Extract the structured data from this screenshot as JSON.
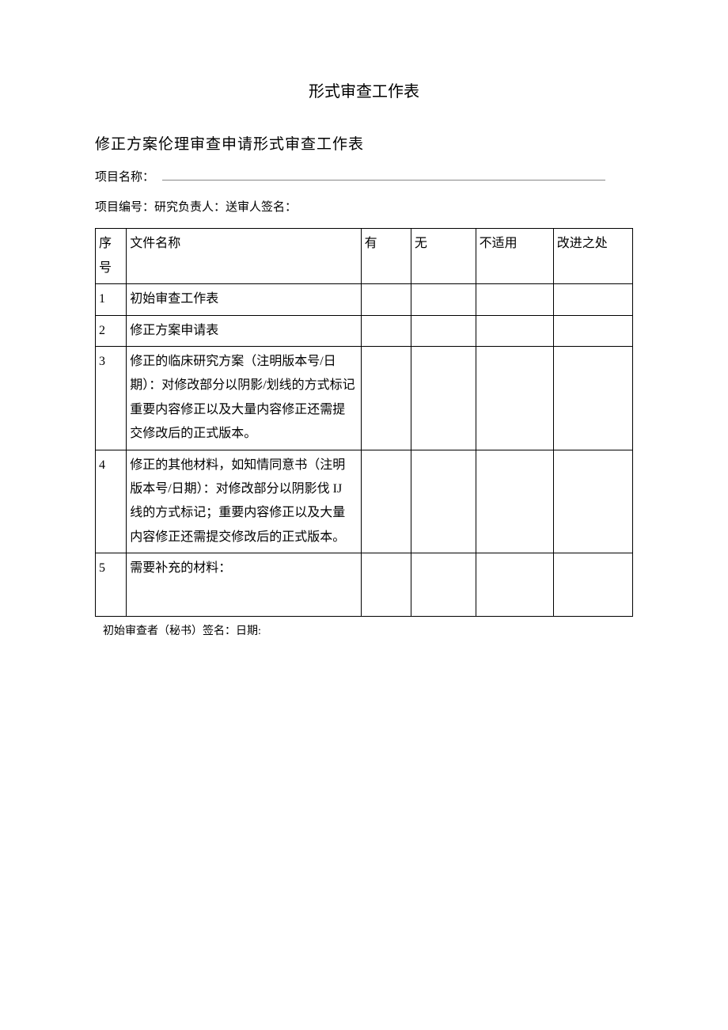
{
  "page_title": "形式审查工作表",
  "section_title": "修正方案伦理审查申请形式审查工作表",
  "meta": {
    "project_name_label": "项目名称：",
    "project_info_line": "项目编号：研究负责人：送审人签名："
  },
  "table": {
    "headers": {
      "seq": "序号",
      "file_name": "文件名称",
      "yes": "有",
      "no": "无",
      "na": "不适用",
      "improve": "改进之处"
    },
    "rows": [
      {
        "seq": "1",
        "name": "初始审查工作表"
      },
      {
        "seq": "2",
        "name": "修正方案申请表"
      },
      {
        "seq": "3",
        "name": "修正的临床研究方案（注明版本号/日期）：对修改部分以阴影/划线的方式标记 重要内容修正以及大量内容修正还需提交修改后的正式版本。"
      },
      {
        "seq": "4",
        "name": "修正的其他材料，如知情同意书（注明版本号/日期）：对修改部分以阴影伐 IJ 线的方式标记；重要内容修正以及大量内容修正还需提交修改后的正式版本。"
      },
      {
        "seq": "5",
        "name": "需要补充的材料："
      }
    ]
  },
  "footer": "初始审查者（秘书）签名：日期:"
}
